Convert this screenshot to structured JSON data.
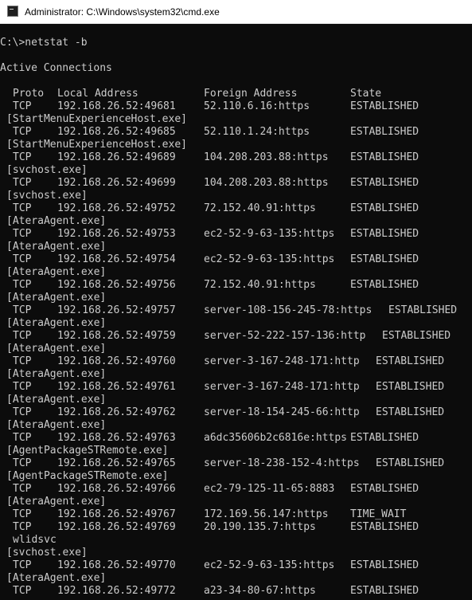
{
  "window": {
    "title": "Administrator: C:\\Windows\\system32\\cmd.exe",
    "icon": "cmd-console-icon"
  },
  "console": {
    "command_line": "C:\\>netstat -b",
    "section_heading": "Active Connections",
    "headers": {
      "proto": "Proto",
      "local": "Local Address",
      "foreign": "Foreign Address",
      "state": "State"
    },
    "connections": [
      {
        "proto": "TCP",
        "local": "192.168.26.52:49681",
        "foreign": "52.110.6.16:https",
        "state": "ESTABLISHED",
        "process": "[StartMenuExperienceHost.exe]"
      },
      {
        "proto": "TCP",
        "local": "192.168.26.52:49685",
        "foreign": "52.110.1.24:https",
        "state": "ESTABLISHED",
        "process": "[StartMenuExperienceHost.exe]"
      },
      {
        "proto": "TCP",
        "local": "192.168.26.52:49689",
        "foreign": "104.208.203.88:https",
        "state": "ESTABLISHED",
        "process": "[svchost.exe]"
      },
      {
        "proto": "TCP",
        "local": "192.168.26.52:49699",
        "foreign": "104.208.203.88:https",
        "state": "ESTABLISHED",
        "process": "[svchost.exe]"
      },
      {
        "proto": "TCP",
        "local": "192.168.26.52:49752",
        "foreign": "72.152.40.91:https",
        "state": "ESTABLISHED",
        "process": "[AteraAgent.exe]"
      },
      {
        "proto": "TCP",
        "local": "192.168.26.52:49753",
        "foreign": "ec2-52-9-63-135:https",
        "state": "ESTABLISHED",
        "process": "[AteraAgent.exe]"
      },
      {
        "proto": "TCP",
        "local": "192.168.26.52:49754",
        "foreign": "ec2-52-9-63-135:https",
        "state": "ESTABLISHED",
        "process": "[AteraAgent.exe]"
      },
      {
        "proto": "TCP",
        "local": "192.168.26.52:49756",
        "foreign": "72.152.40.91:https",
        "state": "ESTABLISHED",
        "process": "[AteraAgent.exe]"
      },
      {
        "proto": "TCP",
        "local": "192.168.26.52:49757",
        "foreign": "server-108-156-245-78:https",
        "state": "ESTABLISHED",
        "process": "[AteraAgent.exe]"
      },
      {
        "proto": "TCP",
        "local": "192.168.26.52:49759",
        "foreign": "server-52-222-157-136:http",
        "state": "ESTABLISHED",
        "process": "[AteraAgent.exe]"
      },
      {
        "proto": "TCP",
        "local": "192.168.26.52:49760",
        "foreign": "server-3-167-248-171:http",
        "state": "ESTABLISHED",
        "process": "[AteraAgent.exe]"
      },
      {
        "proto": "TCP",
        "local": "192.168.26.52:49761",
        "foreign": "server-3-167-248-171:http",
        "state": "ESTABLISHED",
        "process": "[AteraAgent.exe]"
      },
      {
        "proto": "TCP",
        "local": "192.168.26.52:49762",
        "foreign": "server-18-154-245-66:http",
        "state": "ESTABLISHED",
        "process": "[AteraAgent.exe]"
      },
      {
        "proto": "TCP",
        "local": "192.168.26.52:49763",
        "foreign": "a6dc35606b2c6816e:https",
        "state": "ESTABLISHED",
        "process": "[AgentPackageSTRemote.exe]"
      },
      {
        "proto": "TCP",
        "local": "192.168.26.52:49765",
        "foreign": "server-18-238-152-4:https",
        "state": "ESTABLISHED",
        "process": "[AgentPackageSTRemote.exe]"
      },
      {
        "proto": "TCP",
        "local": "192.168.26.52:49766",
        "foreign": "ec2-79-125-11-65:8883",
        "state": "ESTABLISHED",
        "process": "[AteraAgent.exe]"
      },
      {
        "proto": "TCP",
        "local": "192.168.26.52:49767",
        "foreign": "172.169.56.147:https",
        "state": "TIME_WAIT"
      },
      {
        "proto": "TCP",
        "local": "192.168.26.52:49769",
        "foreign": "20.190.135.7:https",
        "state": "ESTABLISHED",
        "service": "wlidsvc",
        "process": "[svchost.exe]"
      },
      {
        "proto": "TCP",
        "local": "192.168.26.52:49770",
        "foreign": "ec2-52-9-63-135:https",
        "state": "ESTABLISHED",
        "process": "[AteraAgent.exe]"
      },
      {
        "proto": "TCP",
        "local": "192.168.26.52:49772",
        "foreign": "a23-34-80-67:https",
        "state": "ESTABLISHED"
      }
    ]
  },
  "colors": {
    "console_background": "#0c0c0c",
    "console_text": "#cccccc",
    "titlebar_background": "#ffffff",
    "titlebar_text": "#000000"
  }
}
